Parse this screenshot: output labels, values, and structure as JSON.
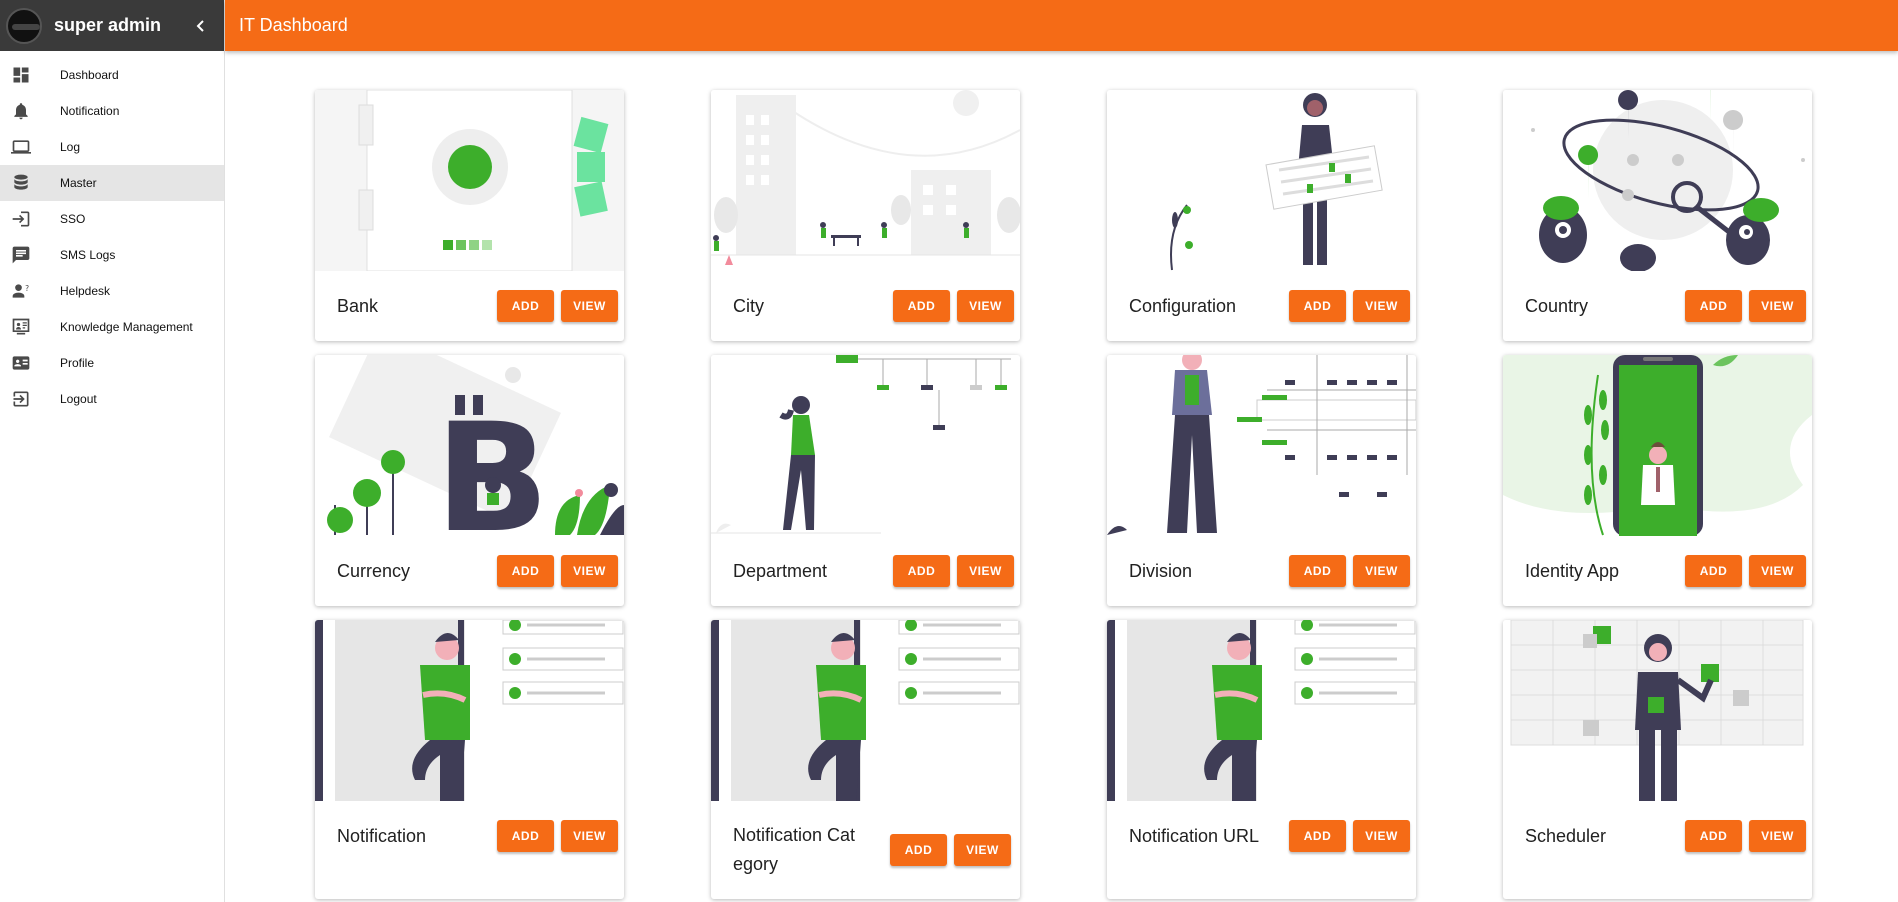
{
  "user": {
    "name": "super admin"
  },
  "header": {
    "title": "IT Dashboard"
  },
  "menu": [
    {
      "label": "Dashboard",
      "icon": "dashboard-icon"
    },
    {
      "label": "Notification",
      "icon": "bell-icon"
    },
    {
      "label": "Log",
      "icon": "laptop-icon"
    },
    {
      "label": "Master",
      "icon": "database-icon",
      "active": true
    },
    {
      "label": "SSO",
      "icon": "login-icon"
    },
    {
      "label": "SMS Logs",
      "icon": "sms-icon"
    },
    {
      "label": "Helpdesk",
      "icon": "person-question-icon"
    },
    {
      "label": "Knowledge Management",
      "icon": "knowledge-icon"
    },
    {
      "label": "Profile",
      "icon": "id-card-icon"
    },
    {
      "label": "Logout",
      "icon": "logout-icon"
    }
  ],
  "buttons": {
    "add": "ADD",
    "view": "VIEW"
  },
  "cards": [
    {
      "title": "Bank"
    },
    {
      "title": "City"
    },
    {
      "title": "Configuration"
    },
    {
      "title": "Country"
    },
    {
      "title": "Currency"
    },
    {
      "title": "Department"
    },
    {
      "title": "Division"
    },
    {
      "title": "Identity App"
    },
    {
      "title": "Notification"
    },
    {
      "title": "Notification Cat egory"
    },
    {
      "title": "Notification URL"
    },
    {
      "title": "Scheduler"
    }
  ],
  "colors": {
    "accent": "#f56b16",
    "green": "#3dae2b",
    "dark": "#3f3d56"
  }
}
